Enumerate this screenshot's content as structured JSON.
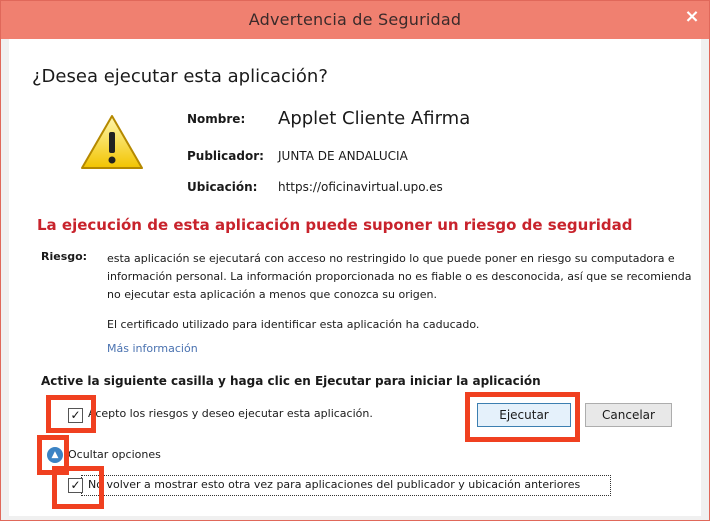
{
  "window": {
    "title": "Advertencia de Seguridad",
    "close_glyph": "×"
  },
  "question": "¿Desea ejecutar esta aplicación?",
  "info": {
    "name_label": "Nombre:",
    "name_value": "Applet Cliente Afirma",
    "publisher_label": "Publicador:",
    "publisher_value": "JUNTA DE ANDALUCIA",
    "location_label": "Ubicación:",
    "location_value": "https://oficinavirtual.upo.es"
  },
  "risk": {
    "title": "La ejecución de esta aplicación puede suponer un riesgo de seguridad",
    "label": "Riesgo:",
    "text": "esta aplicación se ejecutará con acceso no restringido lo que puede poner en riesgo su computadora e información personal. La información proporcionada no es fiable o es desconocida, así que se recomienda no ejecutar esta aplicación a menos que conozca su origen.",
    "certificate": "El certificado utilizado para identificar esta aplicación ha caducado.",
    "more_info": "Más información"
  },
  "instruction": "Active la siguiente casilla y haga clic en Ejecutar para iniciar la aplicación",
  "accept_checkbox": {
    "checked": true,
    "label": "Acepto los riesgos y deseo ejecutar esta aplicación."
  },
  "buttons": {
    "run": "Ejecutar",
    "cancel": "Cancelar"
  },
  "options_toggle": {
    "label": "Ocultar opciones"
  },
  "no_show_checkbox": {
    "checked": true,
    "label": "No volver a mostrar esto otra vez para aplicaciones del publicador y ubicación anteriores"
  },
  "colors": {
    "titlebar": "#f08070",
    "risk_title": "#c8232c",
    "link": "#4a72b0",
    "highlight": "#f04020",
    "default_button_border": "#3c7fb1"
  }
}
